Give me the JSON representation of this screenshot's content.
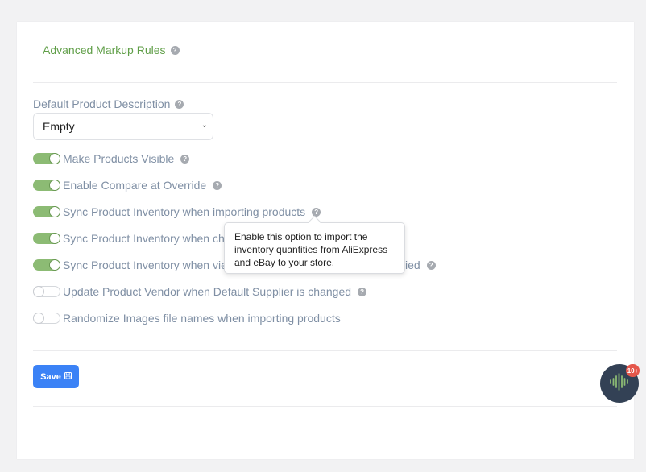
{
  "section": {
    "title": "Advanced Markup Rules"
  },
  "description": {
    "label": "Default Product Description",
    "selected": "Empty"
  },
  "toggles": [
    {
      "label": "Make Products Visible",
      "on": true,
      "help": true
    },
    {
      "label": "Enable Compare at Override",
      "on": true,
      "help": true
    },
    {
      "label": "Sync Product Inventory when importing products",
      "on": true,
      "help": true
    },
    {
      "label": "Sync Product Inventory when changing suppliers",
      "on": true,
      "help": true
    },
    {
      "label": "Sync Product Inventory when viewing ... is modified",
      "on": true,
      "help": true
    },
    {
      "label": "Update Product Vendor when Default Supplier is changed",
      "on": false,
      "help": true
    },
    {
      "label": "Randomize Images file names when importing products",
      "on": false,
      "help": false
    }
  ],
  "toggle_labels_visible": [
    "Make Products Visible",
    "Enable Compare at Override",
    "Sync Product Inventory when importing products",
    "Sync Product Inventory when ch",
    "Sync Product Inventory when vie",
    "Update Product Vendor when Default Supplier is changed",
    "Randomize Images file names when importing products"
  ],
  "toggle_tail_5": "ied",
  "tooltip": {
    "text": "Enable this option to import the inventory quantities from AliExpress and eBay to your store."
  },
  "save_button": {
    "label": "Save"
  },
  "chat": {
    "badge": "10+"
  },
  "help_glyph": "?",
  "colors": {
    "accent_green": "#5f9e47",
    "toggle_on": "#8cbb74",
    "primary_blue": "#3b82f6",
    "label_gray": "#7f8fa4",
    "badge_red": "#e5574b",
    "fab_dark": "#334155"
  }
}
